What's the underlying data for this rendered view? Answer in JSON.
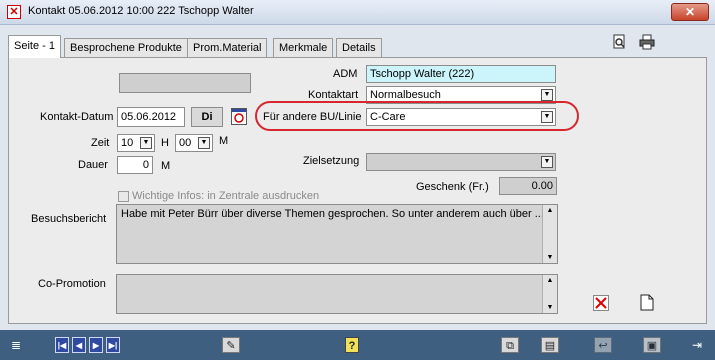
{
  "window": {
    "title": "Kontakt  05.06.2012  10:00  222  Tschopp Walter",
    "close_label": "✕"
  },
  "tabs": [
    {
      "label": "Seite - 1",
      "active": true
    },
    {
      "label": "Besprochene Produkte",
      "active": false
    },
    {
      "label": "Prom.Material",
      "active": false
    },
    {
      "label": "Merkmale",
      "active": false
    },
    {
      "label": "Details",
      "active": false
    }
  ],
  "form": {
    "adm_label": "ADM",
    "adm_value": "Tschopp Walter  (222)",
    "kontaktart_label": "Kontaktart",
    "kontaktart_value": "Normalbesuch",
    "kontakt_datum_label": "Kontakt-Datum",
    "kontakt_datum_value": "05.06.2012",
    "weekday_value": "Di",
    "bu_label": "Für andere BU/Linie",
    "bu_value": "C-Care",
    "zeit_label": "Zeit",
    "zeit_hour": "10",
    "zeit_hour_unit": "H",
    "zeit_min": "00",
    "zeit_min_unit": "M",
    "dauer_label": "Dauer",
    "dauer_value": "0",
    "dauer_unit": "M",
    "zielsetzung_label": "Zielsetzung",
    "zielsetzung_value": "",
    "geschenk_label": "Geschenk (Fr.)",
    "geschenk_value": "0.00",
    "wichtige_label": "Wichtige Infos: in Zentrale ausdrucken",
    "besuchsbericht_label": "Besuchsbericht",
    "besuchsbericht_value": "Habe mit Peter Bürr über diverse Themen gesprochen. So unter anderem auch über ...",
    "copromotion_label": "Co-Promotion",
    "copromotion_value": ""
  },
  "icons": {
    "preview": "print-preview-icon",
    "print": "printer-icon",
    "calendar": "calendar-icon",
    "delete": "delete-icon",
    "new_doc": "new-document-icon"
  },
  "colors": {
    "accent_ring": "#d7262e",
    "bottombar": "#3e5f80",
    "adm_field": "#ccf5fb"
  }
}
